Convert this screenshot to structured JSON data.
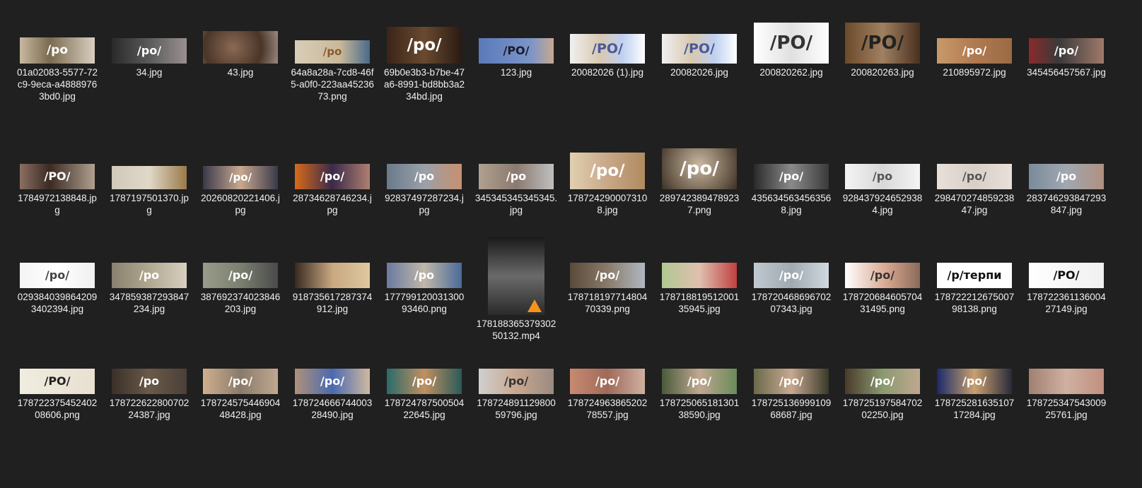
{
  "explorer": {
    "items": [
      {
        "name": "01a02083-5577-72c9-9eca-a48889763bd0.jpg",
        "overlay": "/po",
        "bg": "linear-gradient(90deg,#c8b9a0,#7a6a50 40%,#d9cfc0)",
        "fg": "#ffffff",
        "w": 106,
        "h": 37
      },
      {
        "name": "34.jpg",
        "overlay": "/po/",
        "bg": "linear-gradient(90deg,#2a2a2a,#5a5a5a 50%,#9a9090)",
        "fg": "#ffffff",
        "w": 106,
        "h": 36
      },
      {
        "name": "43.jpg",
        "overlay": "",
        "bg": "radial-gradient(circle at 40% 50%,#8a6a55,#4a3528 60%,#9a8a80)",
        "fg": "#ffffff",
        "w": 106,
        "h": 46
      },
      {
        "name": "64a8a28a-7cd8-46f5-a0f0-223aa4523673.png",
        "overlay": "/po",
        "bg": "linear-gradient(90deg,#d8cdb8,#c9b99a 60%,#4a6a8a)",
        "fg": "#8a5a2a",
        "w": 106,
        "h": 33
      },
      {
        "name": "69b0e3b3-b7be-47a6-8991-bd8bb3a234bd.jpg",
        "overlay": "/po/",
        "bg": "linear-gradient(90deg,#3a2418,#6a4a30 50%,#2a1a12)",
        "fg": "#ffffff",
        "w": 106,
        "h": 52
      },
      {
        "name": "123.jpg",
        "overlay": "/PO/",
        "bg": "linear-gradient(90deg,#5a7ab8,#7c95c8 70%,#c8a890)",
        "fg": "#1a1a2a",
        "w": 106,
        "h": 36
      },
      {
        "name": "20082026 (1).jpg",
        "overlay": "/PO/",
        "bg": "linear-gradient(90deg,#f0f0f0,#d8c8b0 40%,#c0d0f0 70%,#ffffff)",
        "fg": "#4a5a9a",
        "w": 106,
        "h": 42
      },
      {
        "name": "20082026.jpg",
        "overlay": "/PO/",
        "bg": "linear-gradient(90deg,#f0f0f0,#d8c8b0 40%,#c0d0f0 70%,#ffffff)",
        "fg": "#4a5a9a",
        "w": 106,
        "h": 42
      },
      {
        "name": "200820262.jpg",
        "overlay": "/PO/",
        "bg": "linear-gradient(90deg,#ffffff,#e0e0e0 50%,#ffffff)",
        "fg": "#333333",
        "w": 106,
        "h": 58
      },
      {
        "name": "200820263.jpg",
        "overlay": "/PO/",
        "bg": "linear-gradient(90deg,#6a4a2a,#a08060 50%,#4a3020)",
        "fg": "#222222",
        "w": 106,
        "h": 58
      },
      {
        "name": "210895972.jpg",
        "overlay": "/po/",
        "bg": "linear-gradient(90deg,#c89a6a,#b07a50 50%,#9a6a45)",
        "fg": "#ffffff",
        "w": 106,
        "h": 36
      },
      {
        "name": "345456457567.jpg",
        "overlay": "/po/",
        "bg": "linear-gradient(90deg,#8a2a2a,#3a3a3a 40%,#a07a6a)",
        "fg": "#ffffff",
        "w": 106,
        "h": 36
      },
      {
        "name": "1784972138848.jpg",
        "overlay": "/PO/",
        "bg": "linear-gradient(90deg,#8a7060,#3a2a22 40%,#b0a090)",
        "fg": "#ffffff",
        "w": 106,
        "h": 36
      },
      {
        "name": "1787197501370.jpg",
        "overlay": "",
        "bg": "linear-gradient(90deg,#d0c8b8,#e0d8c8 50%,#9a7a4a)",
        "fg": "#ffffff",
        "w": 106,
        "h": 33
      },
      {
        "name": "20260820221406.jpg",
        "overlay": "/po/",
        "bg": "linear-gradient(90deg,#3a3a4a,#c8a890 50%,#3a3a4a)",
        "fg": "#ffffff",
        "w": 106,
        "h": 33
      },
      {
        "name": "28734628746234.jpg",
        "overlay": "/po/",
        "bg": "linear-gradient(90deg,#d86a1a,#3a2a4a 50%,#b08070)",
        "fg": "#ffffff",
        "w": 106,
        "h": 36
      },
      {
        "name": "92837497287234.jpg",
        "overlay": "/po",
        "bg": "linear-gradient(90deg,#6a7a8a,#9aa0a8 50%,#c89070)",
        "fg": "#ffffff",
        "w": 106,
        "h": 36
      },
      {
        "name": "345345345345345.jpg",
        "overlay": "/po",
        "bg": "linear-gradient(90deg,#b0a090,#8a7a70 50%,#c0c0c0)",
        "fg": "#ffffff",
        "w": 106,
        "h": 36
      },
      {
        "name": "1787242900073108.jpg",
        "overlay": "/po/",
        "bg": "linear-gradient(90deg,#e0d0b0,#c8a888 50%,#b08a60)",
        "fg": "#ffffff",
        "w": 106,
        "h": 52
      },
      {
        "name": "2897423894789237.png",
        "overlay": "/po/",
        "bg": "radial-gradient(circle at 50% 40%,#c8b8a0,#6a5a4a 70%,#3a3028)",
        "fg": "#ffffff",
        "w": 106,
        "h": 58
      },
      {
        "name": "4356345634563568.jpg",
        "overlay": "/po/",
        "bg": "linear-gradient(90deg,#2a2a2a,#8a8a8a 50%,#3a3a3a)",
        "fg": "#ffffff",
        "w": 106,
        "h": 36
      },
      {
        "name": "9284379246529384.jpg",
        "overlay": "/po",
        "bg": "linear-gradient(90deg,#f4f4f4,#d8d8d8 50%,#f4f4f4)",
        "fg": "#555555",
        "w": 106,
        "h": 36
      },
      {
        "name": "29847027485923847.jpg",
        "overlay": "/po/",
        "bg": "linear-gradient(90deg,#e8e0d8,#d8d0c8 50%,#e8e0d8)",
        "fg": "#555555",
        "w": 106,
        "h": 36
      },
      {
        "name": "283746293847293847.jpg",
        "overlay": "/po",
        "bg": "linear-gradient(90deg,#7a8a9a,#a0a8b0 50%,#b09080)",
        "fg": "#ffffff",
        "w": 106,
        "h": 36
      },
      {
        "name": "0293840398642093402394.jpg",
        "overlay": "/po/",
        "bg": "linear-gradient(90deg,#f4f4f4,#ffffff 50%,#f0f0f0)",
        "fg": "#444444",
        "w": 106,
        "h": 36
      },
      {
        "name": "347859387293847234.jpg",
        "overlay": "/po",
        "bg": "linear-gradient(90deg,#8a8070,#b0a890 50%,#d8d0c0)",
        "fg": "#ffffff",
        "w": 106,
        "h": 36
      },
      {
        "name": "387692374023846203.jpg",
        "overlay": "/po/",
        "bg": "linear-gradient(90deg,#9a9a8a,#7a8070 50%,#4a4a4a)",
        "fg": "#ffffff",
        "w": 106,
        "h": 36
      },
      {
        "name": "918735617287374912.jpg",
        "overlay": "",
        "bg": "linear-gradient(90deg,#3a2a22,#c8a880 50%,#e0c8a0)",
        "fg": "#ffffff",
        "w": 106,
        "h": 36
      },
      {
        "name": "17779912003130093460.png",
        "overlay": "/po",
        "bg": "linear-gradient(90deg,#6a7aa0,#c0b8a8 50%,#4a6a9a)",
        "fg": "#ffffff",
        "w": 106,
        "h": 36
      },
      {
        "name": "17818836537930250132.mp4",
        "overlay": "",
        "bg": "linear-gradient(180deg,#1a1a1a,#6a6a6a 50%,#2a2a2a)",
        "fg": "#ffffff",
        "w": 80,
        "h": 110,
        "video": true
      },
      {
        "name": "17871819771480470339.png",
        "overlay": "/po/",
        "bg": "linear-gradient(90deg,#5a4a3a,#8a7a6a 50%,#b0b8c0)",
        "fg": "#ffffff",
        "w": 106,
        "h": 36
      },
      {
        "name": "17871881951200135945.jpg",
        "overlay": "",
        "bg": "linear-gradient(90deg,#b0c890,#e0c0b0 50%,#c04040)",
        "fg": "#ffffff",
        "w": 106,
        "h": 36
      },
      {
        "name": "17872046869670207343.jpg",
        "overlay": "/po/",
        "bg": "linear-gradient(90deg,#c0c8d0,#a0a8b0 50%,#d0d8e0)",
        "fg": "#ffffff",
        "w": 106,
        "h": 36
      },
      {
        "name": "17872068460570431495.png",
        "overlay": "/po/",
        "bg": "linear-gradient(90deg,#ffffff,#d8a890 55%,#8a6a5a)",
        "fg": "#333333",
        "w": 106,
        "h": 36
      },
      {
        "name": "17872221267500798138.png",
        "overlay": "/р/терпи",
        "bg": "linear-gradient(90deg,#ffffff,#ffffff)",
        "fg": "#111111",
        "w": 106,
        "h": 36
      },
      {
        "name": "17872236113600427149.jpg",
        "overlay": "/PO/",
        "bg": "linear-gradient(90deg,#ffffff,#f0f0f0)",
        "fg": "#111111",
        "w": 106,
        "h": 36
      },
      {
        "name": "17872237545240208606.png",
        "overlay": "/PO/",
        "bg": "linear-gradient(90deg,#f0ece0,#e8e0d0)",
        "fg": "#222222",
        "w": 106,
        "h": 36
      },
      {
        "name": "17872262280070224387.jpg",
        "overlay": "/po",
        "bg": "linear-gradient(90deg,#3a3028,#6a5a48 50%,#4a4038)",
        "fg": "#ffffff",
        "w": 106,
        "h": 36
      },
      {
        "name": "17872457544690448428.jpg",
        "overlay": "/po/",
        "bg": "linear-gradient(90deg,#d0b090,#8a7a6a 50%,#c0a890)",
        "fg": "#ffffff",
        "w": 106,
        "h": 36
      },
      {
        "name": "17872466674400328490.jpg",
        "overlay": "/po/",
        "bg": "linear-gradient(90deg,#b0907a,#4a6ab0 50%,#d0b8a0)",
        "fg": "#ffffff",
        "w": 106,
        "h": 36
      },
      {
        "name": "17872478750050422645.jpg",
        "overlay": "/po/",
        "bg": "linear-gradient(90deg,#2a6a6a,#c09060 50%,#2a5a5a)",
        "fg": "#ffffff",
        "w": 106,
        "h": 36
      },
      {
        "name": "17872489112980059796.jpg",
        "overlay": "/po/",
        "bg": "linear-gradient(90deg,#d0d0d0,#c8a890 50%,#9a8a80)",
        "fg": "#333333",
        "w": 106,
        "h": 36
      },
      {
        "name": "17872496386520278557.jpg",
        "overlay": "/po/",
        "bg": "linear-gradient(90deg,#c88a70,#a06a5a 50%,#d0b0a0)",
        "fg": "#ffffff",
        "w": 106,
        "h": 36
      },
      {
        "name": "17872506518130138590.jpg",
        "overlay": "/po/",
        "bg": "linear-gradient(90deg,#4a5a3a,#c0a890 50%,#6a8a5a)",
        "fg": "#ffffff",
        "w": 106,
        "h": 36
      },
      {
        "name": "17872513699910968687.jpg",
        "overlay": "/po/",
        "bg": "linear-gradient(90deg,#6a6a4a,#c8a890 50%,#3a3a2a)",
        "fg": "#ffffff",
        "w": 106,
        "h": 36
      },
      {
        "name": "17872519758470202250.jpg",
        "overlay": "/po/",
        "bg": "linear-gradient(90deg,#4a3a2a,#8a9a70 50%,#c0a890)",
        "fg": "#ffffff",
        "w": 106,
        "h": 36
      },
      {
        "name": "17872528163510717284.jpg",
        "overlay": "/po/",
        "bg": "linear-gradient(90deg,#1a2a6a,#c8a070 50%,#2a2a3a)",
        "fg": "#ffffff",
        "w": 106,
        "h": 36
      },
      {
        "name": "17872534754300925761.jpg",
        "overlay": "",
        "bg": "linear-gradient(90deg,#a08070,#d0b0a0 50%,#c09080)",
        "fg": "#ffffff",
        "w": 106,
        "h": 36
      }
    ]
  }
}
